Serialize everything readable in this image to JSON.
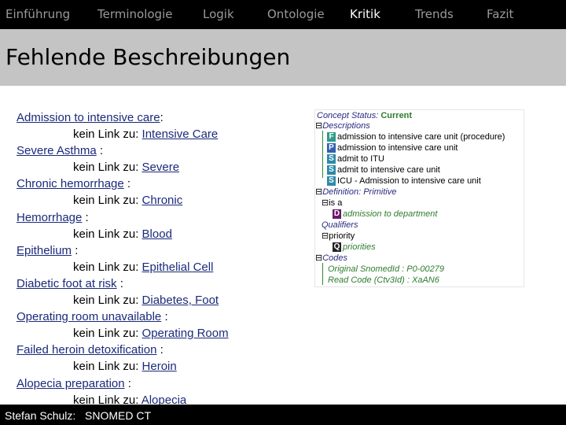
{
  "nav": {
    "items": [
      "Einführung",
      "Terminologie",
      "Logik",
      "Ontologie",
      "Kritik",
      "Trends",
      "Fazit"
    ],
    "active_index": 4
  },
  "title": "Fehlende Beschreibungen",
  "content": {
    "lines": [
      {
        "link": "Admission to intensive care",
        "suffix": ":",
        "indent": false
      },
      {
        "prefix": "kein Link zu: ",
        "link": "Intensive Care ",
        "indent": true
      },
      {
        "link": "Severe Asthma",
        "suffix": " :",
        "indent": false
      },
      {
        "prefix": "kein Link zu: ",
        "link": "Severe",
        "indent": true
      },
      {
        "link": "Chronic hemorrhage",
        "suffix": " :",
        "indent": false
      },
      {
        "prefix": "kein Link zu: ",
        "link": "Chronic",
        "indent": true
      },
      {
        "link": "Hemorrhage",
        "suffix": " :",
        "indent": false
      },
      {
        "prefix": "kein Link zu: ",
        "link": "Blood",
        "indent": true
      },
      {
        "link": "Epithelium",
        "suffix": " :",
        "indent": false
      },
      {
        "prefix": "kein Link zu: ",
        "link": "Epithelial Cell",
        "indent": true
      },
      {
        "link": "Diabetic foot at risk",
        "suffix": " :",
        "indent": false
      },
      {
        "prefix": "kein Link zu: ",
        "link": "Diabetes, Foot",
        "indent": true
      },
      {
        "link": "Operating room unavailable",
        "suffix": " :",
        "indent": false
      },
      {
        "prefix": "kein Link zu: ",
        "link": "Operating Room",
        "indent": true
      },
      {
        "link": "Failed heroin detoxification",
        "suffix": " :",
        "indent": false
      },
      {
        "prefix": "kein Link zu: ",
        "link": "Heroin",
        "indent": true
      },
      {
        "link": "Alopecia preparation",
        "suffix": " :",
        "indent": false
      },
      {
        "prefix": "kein Link zu: ",
        "link": "Alopecia",
        "indent": true
      }
    ]
  },
  "tree": {
    "status_label": "Concept Status:",
    "status_value": "Current",
    "descriptions_label": "Descriptions",
    "descriptions": [
      {
        "badge": "F",
        "text": "admission to intensive care unit (procedure)"
      },
      {
        "badge": "P",
        "text": "admission to intensive care unit"
      },
      {
        "badge": "S",
        "text": "admit to ITU"
      },
      {
        "badge": "S",
        "text": "admit to intensive care unit"
      },
      {
        "badge": "S",
        "text": "ICU - Admission to intensive care unit"
      }
    ],
    "definition_label": "Definition: Primitive",
    "isa_label": "is a",
    "isa_badge": "D",
    "isa_item": "admission to department",
    "qualifiers_label": "Qualifiers",
    "priority_label": "priority",
    "priority_badge": "Q",
    "priority_item": "priorities",
    "codes_label": "Codes",
    "codes": [
      "Original SnomedId : P0-00279",
      "Read Code (Ctv3Id) : XaAN6"
    ]
  },
  "footer": {
    "author": "Stefan Schulz:",
    "topic": "SNOMED CT"
  }
}
